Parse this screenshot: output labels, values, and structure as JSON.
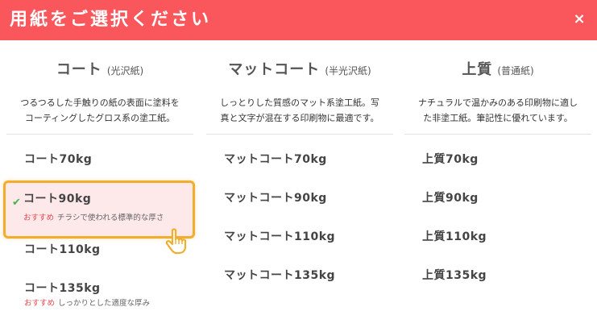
{
  "header": {
    "title": "用紙をご選択ください",
    "close_label": "×"
  },
  "columns": [
    {
      "title": "コート",
      "subtitle": "(光沢紙)",
      "description_lines": [
        "つるつるした手触りの紙の表面に塗料を",
        "コーティングしたグロス系の塗工紙。"
      ],
      "options": [
        {
          "label": "コート70kg"
        },
        {
          "label": "コート90kg",
          "selected": true,
          "recommend": "おすすめ",
          "note": "チラシで使われる標準的な厚さ"
        },
        {
          "label": "コート110kg"
        },
        {
          "label": "コート135kg",
          "recommend": "おすすめ",
          "note": "しっかりとした適度な厚み"
        }
      ]
    },
    {
      "title": "マットコート",
      "subtitle": "(半光沢紙)",
      "description_lines": [
        "しっとりした質感のマット系塗工紙。写",
        "真と文字が混在する印刷物に最適です。"
      ],
      "options": [
        {
          "label": "マットコート70kg"
        },
        {
          "label": "マットコート90kg"
        },
        {
          "label": "マットコート110kg"
        },
        {
          "label": "マットコート135kg"
        }
      ]
    },
    {
      "title": "上質",
      "subtitle": "(普通紙)",
      "description_lines": [
        "ナチュラルで温かみのある印刷物に適し",
        "た非塗工紙。筆記性に優れています。"
      ],
      "options": [
        {
          "label": "上質70kg"
        },
        {
          "label": "上質90kg"
        },
        {
          "label": "上質110kg"
        },
        {
          "label": "上質135kg"
        }
      ]
    }
  ],
  "colors": {
    "header": "#f9575c",
    "selected_border": "#f3ad2c",
    "selected_bg": "#fde8ea",
    "check": "#4caf50",
    "recommend": "#e8474c"
  },
  "icons": {
    "close": "close-icon",
    "check": "check-icon",
    "pointer": "hand-pointer-icon"
  }
}
